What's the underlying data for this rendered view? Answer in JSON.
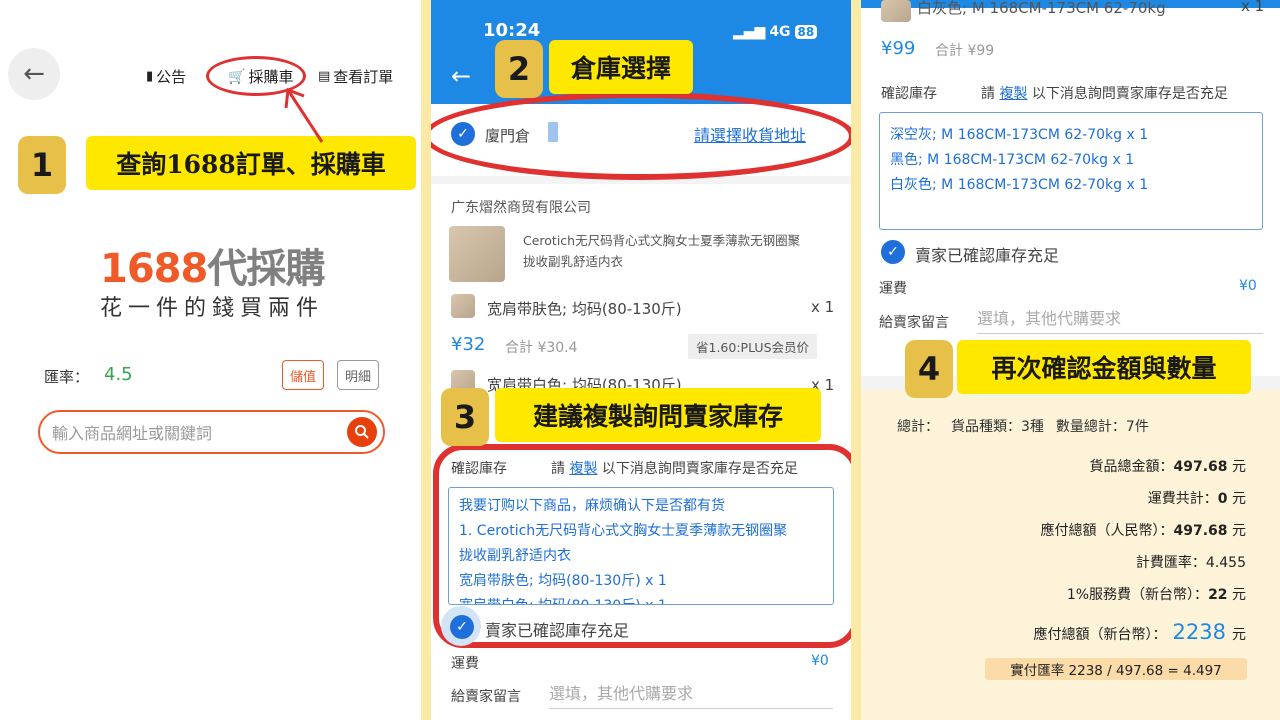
{
  "p1": {
    "nav": {
      "announce": "公告",
      "cart": "採購車",
      "orders": "查看訂單"
    },
    "logo": {
      "num": "1688",
      "text": "代採購",
      "slogan": "花一件的錢買兩件"
    },
    "rate": {
      "label": "匯率：",
      "value": "4.5"
    },
    "buttons": {
      "topup": "儲值",
      "detail": "明細"
    },
    "search": {
      "placeholder": "輸入商品網址或關鍵詞"
    },
    "step": {
      "num": "1",
      "text": "查詢1688訂單、採購車"
    }
  },
  "p2": {
    "status": {
      "time": "10:24",
      "net": "4G",
      "battery": "88"
    },
    "step": {
      "num": "2",
      "text": "倉庫選擇"
    },
    "warehouse": {
      "name": "廈門倉",
      "select_link": "請選擇收貨地址"
    },
    "seller": "广东熠然商贸有限公司",
    "product": {
      "title_line1": "Cerotich无尺码背心式文胸女士夏季薄款无钢圈聚",
      "title_line2": "拢收副乳舒适内衣"
    },
    "variant1": {
      "name": "宽肩带肤色; 均码(80-130斤)",
      "qty": "x 1"
    },
    "price": {
      "amount": "¥32",
      "subtotal": "合計 ¥30.4",
      "promo": "省1.60:PLUS会员价"
    },
    "variant2": {
      "name": "宽肩带白色; 均码(80-130斤)",
      "qty": "x 1"
    },
    "step3": {
      "num": "3",
      "text": "建議複製詢問賣家庫存"
    },
    "confirm": {
      "label": "確認庫存",
      "pre": "請",
      "copy": "複製",
      "post": "以下消息詢問賣家庫存是否充足"
    },
    "message": [
      "我要订购以下商品，麻烦确认下是否都有货",
      "1. Cerotich无尺码背心式文胸女士夏季薄款无钢圈聚",
      "拢收副乳舒适内衣",
      "宽肩带肤色; 均码(80-130斤) x 1",
      "宽肩带白色; 均码(80-130斤) x 1"
    ],
    "seller_confirmed": "賣家已確認庫存充足",
    "shipping": {
      "label": "運費",
      "value": "¥0"
    },
    "note": {
      "label": "給賣家留言",
      "placeholder": "選填，其他代購要求"
    }
  },
  "p3": {
    "top_item": {
      "name": "白灰色; M 168CM-173CM 62-70kg",
      "qty": "x 1"
    },
    "price": {
      "amount": "¥99",
      "subtotal": "合計 ¥99"
    },
    "confirm": {
      "label": "確認庫存",
      "pre": "請",
      "copy": "複製",
      "post": "以下消息詢問賣家庫存是否充足"
    },
    "message": [
      "深空灰; M 168CM-173CM 62-70kg x 1",
      "黑色; M 168CM-173CM 62-70kg x 1",
      "白灰色; M 168CM-173CM 62-70kg x 1"
    ],
    "seller_confirmed": "賣家已確認庫存充足",
    "shipping": {
      "label": "運費",
      "value": "¥0"
    },
    "note": {
      "label": "給賣家留言",
      "placeholder": "選填，其他代購要求"
    },
    "step": {
      "num": "4",
      "text": "再次確認金額與數量"
    },
    "summary": {
      "total_label": "總計：",
      "types": "貨品種類：3種",
      "count": "數量總計：7件",
      "goods_label": "貨品總金額：",
      "goods_value": "497.68",
      "goods_unit": "元",
      "ship_label": "運費共計：",
      "ship_value": "0",
      "ship_unit": "元",
      "rmb_label": "應付總額（人民幣）：",
      "rmb_value": "497.68",
      "rmb_unit": "元",
      "rate_label": "計費匯率：",
      "rate_value": "4.455",
      "fee_label": "1%服務費（新台幣）：",
      "fee_value": "22",
      "fee_unit": "元",
      "twd_label": "應付總額（新台幣）：",
      "twd_value": "2238",
      "twd_unit": "元",
      "actual_rate": "實付匯率 2238 / 497.68 = 4.497"
    }
  },
  "colors": {
    "brand_orange": "#f05a28",
    "blue": "#1e88e5",
    "callout": "#ffe800",
    "badge": "#e7c04a",
    "ring": "#e03131",
    "bg": "#fbe9a6"
  }
}
